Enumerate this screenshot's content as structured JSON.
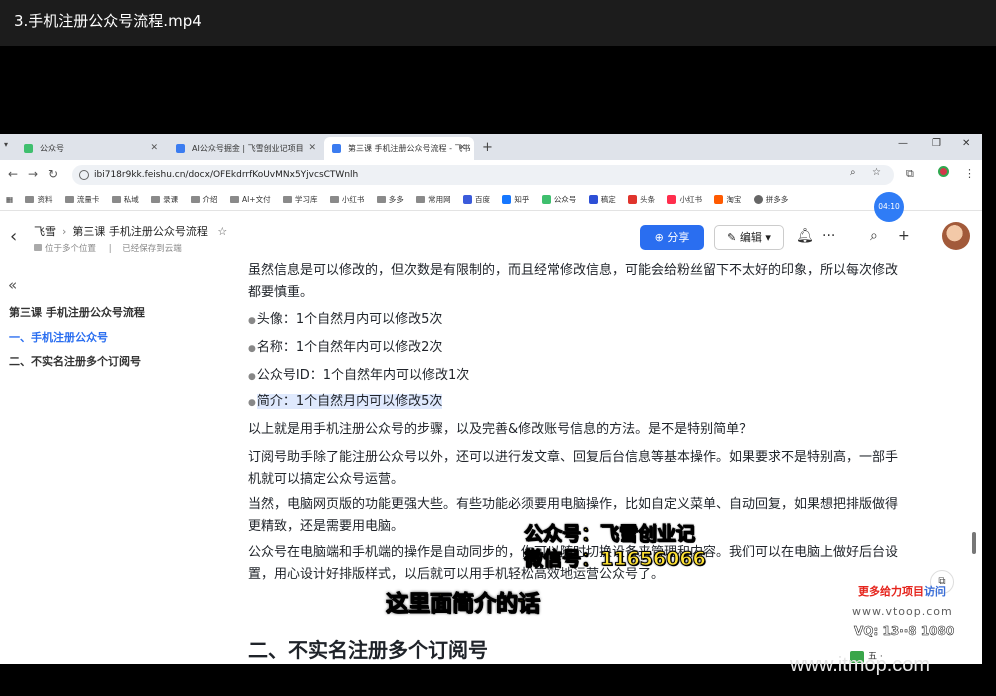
{
  "player": {
    "title": "3.手机注册公众号流程.mp4"
  },
  "browser": {
    "tabs": [
      {
        "label": "公众号",
        "active": false
      },
      {
        "label": "AI公众号掘金 | 飞雪创业记项目",
        "active": false
      },
      {
        "label": "第三课 手机注册公众号流程 - 飞书",
        "active": true
      }
    ],
    "url": "ibi718r9kk.feishu.cn/docx/OFEkdrrfKoUvMNx5YjvcsCTWnlh",
    "bookmarks": [
      "资料",
      "流量卡",
      "私域",
      "录课",
      "介绍",
      "AI+文付",
      "学习库",
      "小红书",
      "多多",
      "常用网",
      "百度",
      "知乎",
      "公众号",
      "稿定",
      "头条",
      "小红书",
      "淘宝",
      "拼多多"
    ],
    "timer": "04:10"
  },
  "doc": {
    "breadcrumb_root": "飞雪",
    "title": "第三课 手机注册公众号流程",
    "location": "位于多个位置",
    "save_status": "已经保存到云端",
    "share_label": "分享",
    "edit_label": "编辑"
  },
  "toc": {
    "title": "第三课 手机注册公众号流程",
    "items": [
      "一、手机注册公众号",
      "二、不实名注册多个订阅号"
    ]
  },
  "content": {
    "p1": "虽然信息是可以修改的，但次数是有限制的，而且经常修改信息，可能会给粉丝留下不太好的印象，所以每次修改都要慎重。",
    "bullets": [
      "头像：1个自然月内可以修改5次",
      "名称：1个自然年内可以修改2次",
      "公众号ID：1个自然年内可以修改1次",
      "简介：1个自然月内可以修改5次"
    ],
    "p2": "以上就是用手机注册公众号的步骤，以及完善&修改账号信息的方法。是不是特别简单？",
    "p3": "订阅号助手除了能注册公众号以外，还可以进行发文章、回复后台信息等基本操作。如果要求不是特别高，一部手机就可以搞定公众号运营。",
    "p4": "当然，电脑网页版的功能更强大些。有些功能必须要用电脑操作，比如自定义菜单、自动回复，如果想把排版做得更精致，还是需要用电脑。",
    "p5": "公众号在电脑端和手机端的操作是自动同步的，你可以随时切换设备来管理和内容。我们可以在电脑上做好后台设置，用心设计好排版样式，以后就可以用手机轻松高效地运营公众号了。",
    "h2": "二、不实名注册多个订阅号"
  },
  "overlay": {
    "caption_line1": "公众号：飞雪创业记",
    "caption_line2": "微信号：11656066",
    "subtitle": "这里面简介的话",
    "promo": "更多给力项目",
    "promo_link": "访问",
    "wm_url": "www.vtoop.com",
    "wm_vq": "VQ: 13··8 1080",
    "wm_site": "www.itmop.com",
    "wm_bottom": "五 ·  "
  }
}
